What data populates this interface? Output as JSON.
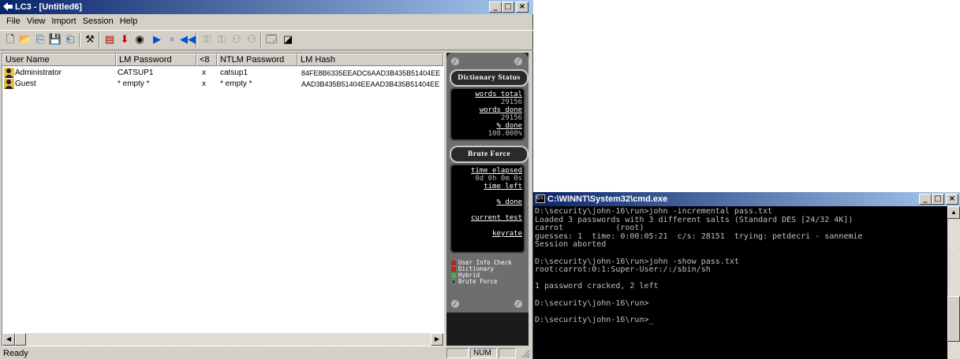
{
  "lc3": {
    "title": "LC3 - [Untitled6]",
    "menu": [
      "File",
      "View",
      "Import",
      "Session",
      "Help"
    ],
    "toolbar_icons": [
      "new-icon",
      "open-icon",
      "import-icon",
      "save-icon",
      "export-icon",
      "wizard-icon",
      "grid-icon",
      "download-icon",
      "options-icon",
      "play-icon",
      "pause-icon",
      "rewind-icon",
      "key-icon",
      "key2-icon",
      "users-icon",
      "users2-icon",
      "window-icon",
      "fullscreen-icon"
    ],
    "columns": [
      "User Name",
      "LM Password",
      "<8",
      "NTLM Password",
      "LM Hash"
    ],
    "rows": [
      {
        "user": "Administrator",
        "lm_password": "CATSUP1",
        "lt8": "x",
        "ntlm_password": "catsup1",
        "lm_hash": "84FE8B6335EEADC6AAD3B435B51404EE"
      },
      {
        "user": "Guest",
        "lm_password": "* empty *",
        "lt8": "x",
        "ntlm_password": "* empty *",
        "lm_hash": "AAD3B435B51404EEAAD3B435B51404EE"
      }
    ],
    "status_panel": {
      "dictionary_title": "Dictionary Status",
      "words_total_label": "words total",
      "words_total": "29156",
      "words_done_label": "words done",
      "words_done": "29156",
      "pct_done_label": "% done",
      "pct_done": "100.000%",
      "brute_title": "Brute Force",
      "time_elapsed_label": "time elapsed",
      "time_elapsed": "0d 0h 0m 0s",
      "time_left_label": "time left",
      "brute_pct_label": "% done",
      "current_test_label": "current test",
      "keyrate_label": "keyrate",
      "options": [
        {
          "label": "User Info Check",
          "state": "red"
        },
        {
          "label": "Dictionary",
          "state": "red"
        },
        {
          "label": "Hybrid",
          "state": "green"
        },
        {
          "label": "Brute Force",
          "state": "off"
        }
      ]
    },
    "status_text": "Ready",
    "num_indicator": "NUM"
  },
  "cmd": {
    "title": "C:\\WINNT\\System32\\cmd.exe",
    "lines": [
      "D:\\security\\john-16\\run>john -incremental pass.txt",
      "Loaded 3 passwords with 3 different salts (Standard DES [24/32 4K])",
      "carrot           (root)",
      "guesses: 1  time: 0:00:05:21  c/s: 28151  trying: petdecri - sannemie",
      "Session aborted",
      "",
      "D:\\security\\john-16\\run>john -show pass.txt",
      "root:carrot:0:1:Super-User:/:/sbin/sh",
      "",
      "1 password cracked, 2 left",
      "",
      "D:\\security\\john-16\\run>",
      "",
      "D:\\security\\john-16\\run>_"
    ]
  }
}
